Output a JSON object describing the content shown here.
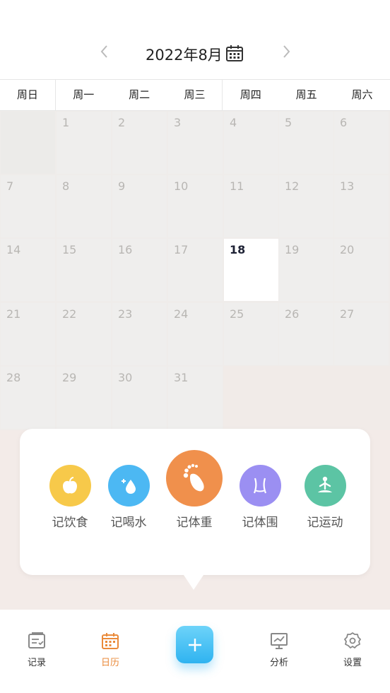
{
  "header": {
    "month_title": "2022年8月",
    "prev_icon": "chevron-left-icon",
    "next_icon": "chevron-right-icon",
    "calendar_icon": "calendar-icon"
  },
  "weekdays": [
    "周日",
    "周一",
    "周二",
    "周三",
    "周四",
    "周五",
    "周六"
  ],
  "calendar": {
    "rows": [
      [
        "",
        "1",
        "2",
        "3",
        "4",
        "5",
        "6"
      ],
      [
        "7",
        "8",
        "9",
        "10",
        "11",
        "12",
        "13"
      ],
      [
        "14",
        "15",
        "16",
        "17",
        "18",
        "19",
        "20"
      ],
      [
        "21",
        "22",
        "23",
        "24",
        "25",
        "26",
        "27"
      ],
      [
        "28",
        "29",
        "30",
        "31",
        "",
        "",
        ""
      ]
    ],
    "today": "18"
  },
  "quick_actions": [
    {
      "label": "记饮食",
      "icon": "apple-icon",
      "color": "#f7c94a"
    },
    {
      "label": "记喝水",
      "icon": "water-drop-icon",
      "color": "#4cb8f3"
    },
    {
      "label": "记体重",
      "icon": "footprint-icon",
      "color": "#f0904c"
    },
    {
      "label": "记体围",
      "icon": "waist-icon",
      "color": "#9b8ff2"
    },
    {
      "label": "记运动",
      "icon": "yoga-icon",
      "color": "#5cc4a4"
    }
  ],
  "tabbar": {
    "items": [
      {
        "label": "记录",
        "icon": "record-icon"
      },
      {
        "label": "日历",
        "icon": "calendar-icon",
        "active": true
      },
      {
        "label": "分析",
        "icon": "chart-board-icon"
      },
      {
        "label": "设置",
        "icon": "gear-icon"
      }
    ],
    "add_icon": "plus-icon",
    "colors": {
      "active": "#ea8a3a",
      "inactive": "#8a8a8a",
      "add_button": "#34b5f1"
    }
  }
}
